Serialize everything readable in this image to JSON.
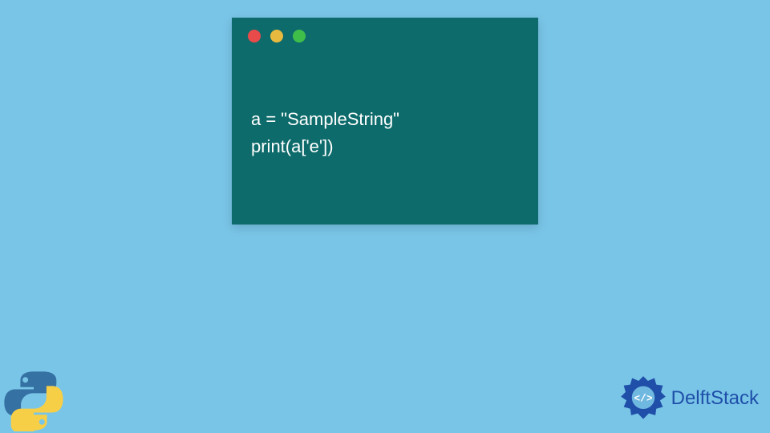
{
  "code_window": {
    "traffic_lights": [
      "red",
      "yellow",
      "green"
    ],
    "lines": [
      "a = \"SampleString\"",
      "print(a['e'])"
    ]
  },
  "brand": {
    "name": "DelftStack",
    "tag_text": "</>"
  },
  "logos": {
    "bottom_left": "python-icon",
    "bottom_right": "delftstack-icon"
  },
  "colors": {
    "page_bg": "#79c5e8",
    "window_bg": "#0e6b6b",
    "code_fg": "#ffffff",
    "brand_fg": "#1f4fa8",
    "python_blue": "#3571a3",
    "python_yellow": "#f7cf46"
  }
}
